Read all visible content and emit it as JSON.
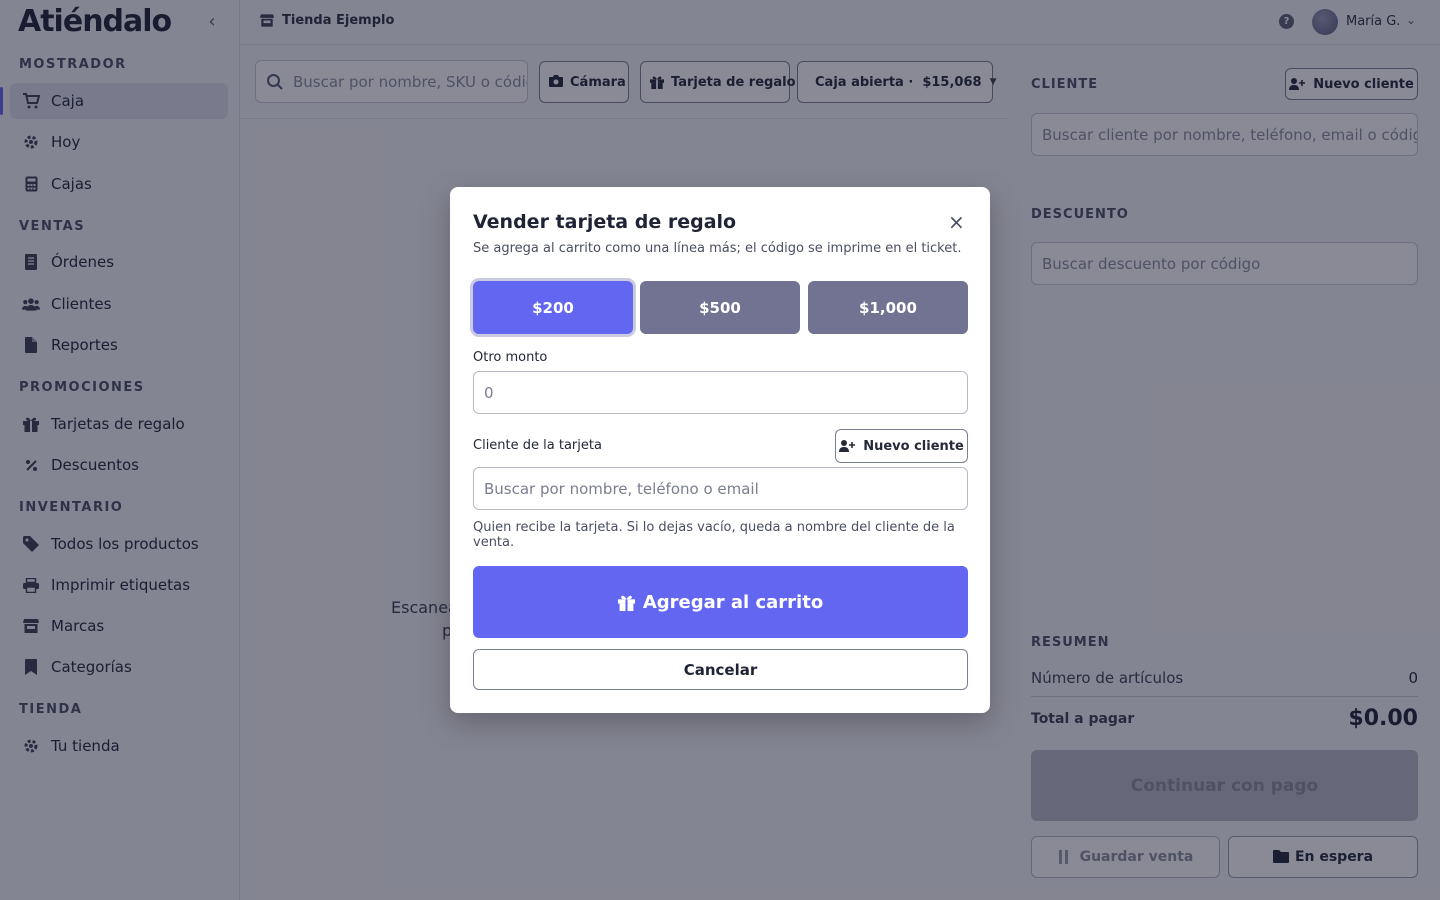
{
  "app": {
    "brand": "Atiéndalo"
  },
  "topbar": {
    "store_name": "Tienda Ejemplo",
    "help": "?",
    "user_name": "María G."
  },
  "sidebar": {
    "sections": [
      {
        "title": "MOSTRADOR",
        "items": [
          {
            "label": "Caja",
            "icon": "cart-icon",
            "active": true
          },
          {
            "label": "Hoy",
            "icon": "gear-icon"
          },
          {
            "label": "Cajas",
            "icon": "calculator-icon"
          }
        ]
      },
      {
        "title": "VENTAS",
        "items": [
          {
            "label": "Órdenes",
            "icon": "receipt-icon"
          },
          {
            "label": "Clientes",
            "icon": "users-icon"
          },
          {
            "label": "Reportes",
            "icon": "file-icon"
          }
        ]
      },
      {
        "title": "PROMOCIONES",
        "items": [
          {
            "label": "Tarjetas de regalo",
            "icon": "gift-icon"
          },
          {
            "label": "Descuentos",
            "icon": "percent-icon"
          }
        ]
      },
      {
        "title": "INVENTARIO",
        "items": [
          {
            "label": "Todos los productos",
            "icon": "tag-icon"
          },
          {
            "label": "Imprimir etiquetas",
            "icon": "printer-icon"
          },
          {
            "label": "Marcas",
            "icon": "store-icon"
          },
          {
            "label": "Categorías",
            "icon": "bookmark-icon"
          }
        ]
      },
      {
        "title": "TIENDA",
        "items": [
          {
            "label": "Tu tienda",
            "icon": "gear-icon"
          }
        ]
      }
    ]
  },
  "main": {
    "search_placeholder": "Buscar por nombre, SKU o código",
    "camera_label": "Cámara",
    "giftcard_label": "Tarjeta de regalo",
    "register_label": "Caja abierta ·",
    "register_amount": "$15,068",
    "empty_line1": "Escanea",
    "empty_line2": "p"
  },
  "right_panel": {
    "client_title": "CLIENTE",
    "new_client_label": "Nuevo cliente",
    "client_search_placeholder": "Buscar cliente por nombre, teléfono, email o código",
    "discount_title": "DESCUENTO",
    "discount_placeholder": "Buscar descuento por código",
    "summary_title": "RESUMEN",
    "items_label": "Número de artículos",
    "items_value": "0",
    "total_label": "Total a pagar",
    "total_value": "$0.00",
    "pay_label": "Continuar con pago",
    "save_label": "Guardar venta",
    "hold_label": "En espera"
  },
  "modal": {
    "title": "Vender tarjeta de regalo",
    "subtitle": "Se agrega al carrito como una línea más; el código se imprime en el ticket.",
    "close": "×",
    "amounts": [
      {
        "label": "$200",
        "selected": true
      },
      {
        "label": "$500",
        "selected": false
      },
      {
        "label": "$1,000",
        "selected": false
      }
    ],
    "other_amount_label": "Otro monto",
    "other_amount_value": "0",
    "card_client_label": "Cliente de la tarjeta",
    "new_client_label": "Nuevo cliente",
    "card_client_placeholder": "Buscar por nombre, teléfono o email",
    "hint": "Quien recibe la tarjeta. Si lo dejas vacío, queda a nombre del cliente de la venta.",
    "add_label": "Agregar al carrito",
    "cancel_label": "Cancelar"
  },
  "colors": {
    "accent": "#6366f1",
    "amount_default": "#727392",
    "status_open": "#22a35a"
  }
}
